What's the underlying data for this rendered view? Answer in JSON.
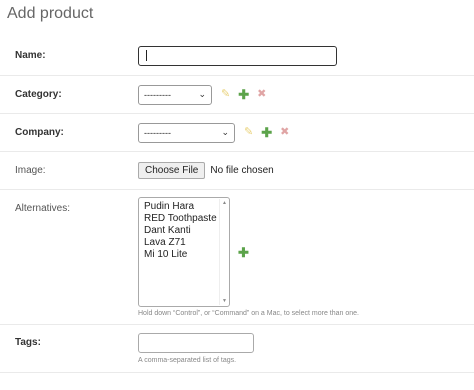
{
  "page": {
    "title": "Add product"
  },
  "fields": {
    "name": {
      "label": "Name:",
      "value": ""
    },
    "category": {
      "label": "Category:",
      "selected": "---------"
    },
    "company": {
      "label": "Company:",
      "selected": "---------"
    },
    "image": {
      "label": "Image:",
      "button": "Choose File",
      "status": "No file chosen"
    },
    "alternatives": {
      "label": "Alternatives:",
      "options": [
        "Pudin Hara",
        "RED Toothpaste",
        "Dant Kanti",
        "Lava Z71",
        "Mi 10 Lite"
      ],
      "help": "Hold down “Control”, or “Command” on a Mac, to select more than one."
    },
    "tags": {
      "label": "Tags:",
      "value": "",
      "help": "A comma-separated list of tags."
    }
  },
  "icons": {
    "edit": "✎",
    "add": "✚",
    "delete": "✖",
    "chevron": "⌄",
    "scroll_up": "▲",
    "scroll_down": "▼"
  },
  "colors": {
    "edit": "#e9d27a",
    "add": "#5ca34a",
    "delete": "#e0a5a5"
  }
}
